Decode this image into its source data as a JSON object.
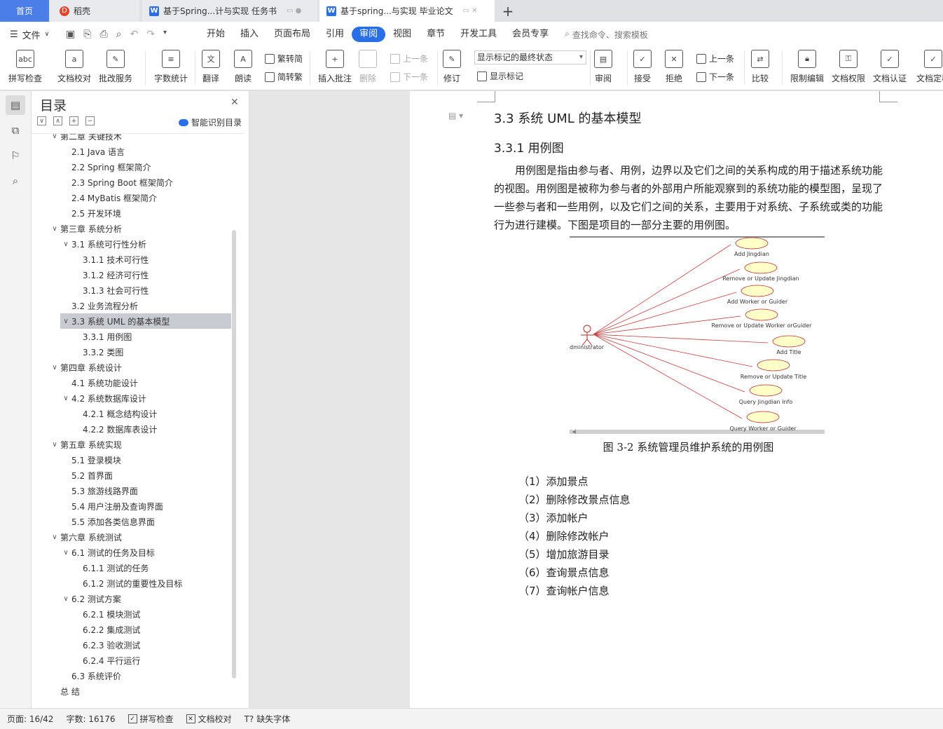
{
  "tabs": {
    "home": "首页",
    "daoke": "稻壳",
    "doc1": "基于Spring...计与实现 任务书",
    "doc2": "基于spring...与实现 毕业论文",
    "add": "+"
  },
  "menu": {
    "file": "文件",
    "tabs": [
      "开始",
      "插入",
      "页面布局",
      "引用",
      "审阅",
      "视图",
      "章节",
      "开发工具",
      "会员专享"
    ],
    "active_tab": "审阅",
    "search": "查找命令、搜索模板"
  },
  "ribbon": {
    "spell_check": "拼写检查",
    "doc_proof": "文档校对",
    "batch_revise": "批改服务",
    "word_count": "字数统计",
    "translate": "翻译",
    "read_aloud": "朗读",
    "trad_conv": "繁转简",
    "simp_conv": "简转繁",
    "insert_comment": "插入批注",
    "delete": "删除",
    "prev": "上一条",
    "next": "下一条",
    "revise": "修订",
    "markup_select": "显示标记的最终状态",
    "show_markup": "显示标记",
    "review": "审阅",
    "accept": "接受",
    "reject": "拒绝",
    "prev2": "上一条",
    "next2": "下一条",
    "compare": "比较",
    "restrict_edit": "限制编辑",
    "doc_rights": "文档权限",
    "doc_cert": "文档认证",
    "doc_finalize": "文档定稿"
  },
  "toc": {
    "title": "目录",
    "smart": "智能识别目录",
    "items": [
      {
        "label": "第二章  关键技术",
        "level": 0,
        "chev": "∨"
      },
      {
        "label": "2.1 Java 语言",
        "level": 1,
        "chev": ""
      },
      {
        "label": "2.2 Spring 框架简介",
        "level": 1,
        "chev": ""
      },
      {
        "label": "2.3 Spring Boot 框架简介",
        "level": 1,
        "chev": ""
      },
      {
        "label": "2.4 MyBatis  框架简介",
        "level": 1,
        "chev": ""
      },
      {
        "label": "2.5  开发环境",
        "level": 1,
        "chev": ""
      },
      {
        "label": "第三章  系统分析",
        "level": 0,
        "chev": "∨"
      },
      {
        "label": "3.1  系统可行性分析",
        "level": 1,
        "chev": "∨"
      },
      {
        "label": "3.1.1  技术可行性",
        "level": 2,
        "chev": ""
      },
      {
        "label": "3.1.2  经济可行性",
        "level": 2,
        "chev": ""
      },
      {
        "label": "3.1.3  社会可行性",
        "level": 2,
        "chev": ""
      },
      {
        "label": "3.2  业务流程分析",
        "level": 1,
        "chev": ""
      },
      {
        "label": "3.3  系统 UML 的基本模型",
        "level": 1,
        "chev": "∨",
        "selected": true
      },
      {
        "label": "3.3.1  用例图",
        "level": 2,
        "chev": ""
      },
      {
        "label": "3.3.2  类图",
        "level": 2,
        "chev": ""
      },
      {
        "label": "第四章  系统设计",
        "level": 0,
        "chev": "∨"
      },
      {
        "label": "4.1  系统功能设计",
        "level": 1,
        "chev": ""
      },
      {
        "label": "4.2  系统数据库设计",
        "level": 1,
        "chev": "∨"
      },
      {
        "label": "4.2.1  概念结构设计",
        "level": 2,
        "chev": ""
      },
      {
        "label": "4.2.2  数据库表设计",
        "level": 2,
        "chev": ""
      },
      {
        "label": "第五章  系统实现",
        "level": 0,
        "chev": "∨"
      },
      {
        "label": "5.1 登录模块",
        "level": 1,
        "chev": ""
      },
      {
        "label": "5.2  首界面",
        "level": 1,
        "chev": ""
      },
      {
        "label": "5.3  旅游线路界面",
        "level": 1,
        "chev": ""
      },
      {
        "label": "5.4  用户注册及查询界面",
        "level": 1,
        "chev": ""
      },
      {
        "label": "5.5  添加各类信息界面",
        "level": 1,
        "chev": ""
      },
      {
        "label": "第六章  系统测试",
        "level": 0,
        "chev": "∨"
      },
      {
        "label": "6.1 测试的任务及目标",
        "level": 1,
        "chev": "∨"
      },
      {
        "label": "6.1.1 测试的任务",
        "level": 2,
        "chev": ""
      },
      {
        "label": "6.1.2 测试的重要性及目标",
        "level": 2,
        "chev": ""
      },
      {
        "label": "6.2 测试方案",
        "level": 1,
        "chev": "∨"
      },
      {
        "label": "6.2.1 模块测试",
        "level": 2,
        "chev": ""
      },
      {
        "label": "6.2.2 集成测试",
        "level": 2,
        "chev": ""
      },
      {
        "label": "6.2.3 验收测试",
        "level": 2,
        "chev": ""
      },
      {
        "label": "6.2.4 平行运行",
        "level": 2,
        "chev": ""
      },
      {
        "label": "6.3 系统评价",
        "level": 1,
        "chev": ""
      },
      {
        "label": "总   结",
        "level": 0,
        "chev": ""
      }
    ]
  },
  "doc": {
    "heading": "3.3  系统 UML 的基本模型",
    "subheading": "3.3.1  用例图",
    "paragraph": "用例图是指由参与者、用例，边界以及它们之间的关系构成的用于描述系统功能的视图。用例图是被称为参与者的外部用户所能观察到的系统功能的模型图，呈现了一些参与者和一些用例，以及它们之间的关系，主要用于对系统、子系统或类的功能行为进行建模。下图是项目的一部分主要的用例图。",
    "figure": {
      "actor": "dministrator",
      "use_cases": [
        "Add  Jingdian",
        "Remove or Update Jingdian",
        "Add Worker or Guider",
        "Remove or Update Worker orGuider",
        "Add Title",
        "Remove or Update Title",
        "Query Jingdian Info",
        "Query Worker or Guider"
      ]
    },
    "caption": "图 3-2 系统管理员维护系统的用例图",
    "list": [
      "（1）添加景点",
      "（2）删除修改景点信息",
      "（3）添加帐户",
      "（4）删除修改帐户",
      "（5）增加旅游目录",
      "（6）查询景点信息",
      "（7）查询帐户信息"
    ]
  },
  "status": {
    "page": "页面: 16/42",
    "words": "字数: 16176",
    "spell": "拼写检查",
    "proof": "文档校对",
    "missing_font": "缺失字体"
  }
}
